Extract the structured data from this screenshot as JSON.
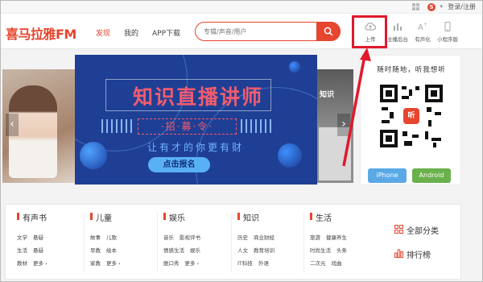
{
  "header": {
    "logo_text": "喜马拉雅FM",
    "nav": [
      "发现",
      "我的",
      "APP下载"
    ],
    "search_placeholder": "专辑/声音/用户",
    "tools": [
      "上传",
      "主播后台",
      "有声化",
      "小程序版"
    ],
    "login_text": "登录/注册"
  },
  "banner": {
    "title": "知识直播讲师",
    "recruit": "·招·募·令·",
    "slogan": "让有才的你更有财",
    "cta": "点击报名",
    "right_thumb_text": "知识"
  },
  "qr_panel": {
    "tagline": "随时随地，听我想听",
    "logo_char": "听",
    "iphone_label": "iPhone",
    "android_label": "Android"
  },
  "categories": [
    {
      "title": "有声书",
      "rows": [
        [
          "文学",
          "悬疑"
        ],
        [
          "生活",
          "悬疑"
        ],
        [
          "教材",
          "更多 ›"
        ]
      ]
    },
    {
      "title": "儿童",
      "rows": [
        [
          "故事",
          "儿歌"
        ],
        [
          "早教",
          "绘本"
        ],
        [
          "家教",
          "更多 ›"
        ]
      ]
    },
    {
      "title": "娱乐",
      "rows": [
        [
          "音乐",
          "影视评书"
        ],
        [
          "情感生活",
          "娱乐"
        ],
        [
          "脱口秀",
          "更多 ›"
        ]
      ]
    },
    {
      "title": "知识",
      "rows": [
        [
          "历史",
          "商业财经"
        ],
        [
          "人文",
          "教育培训"
        ],
        [
          "IT科技",
          "外语"
        ]
      ]
    },
    {
      "title": "生活",
      "rows": [
        [
          "旅游",
          "健康养生"
        ],
        [
          "时尚生活",
          "头条"
        ],
        [
          "二次元",
          "戏曲"
        ]
      ]
    }
  ],
  "side_links": {
    "all": "全部分类",
    "rank": "排行榜"
  },
  "colors": {
    "brand": "#e6452e",
    "highlight": "#e0192d",
    "banner_bg": "#1f3f95"
  }
}
